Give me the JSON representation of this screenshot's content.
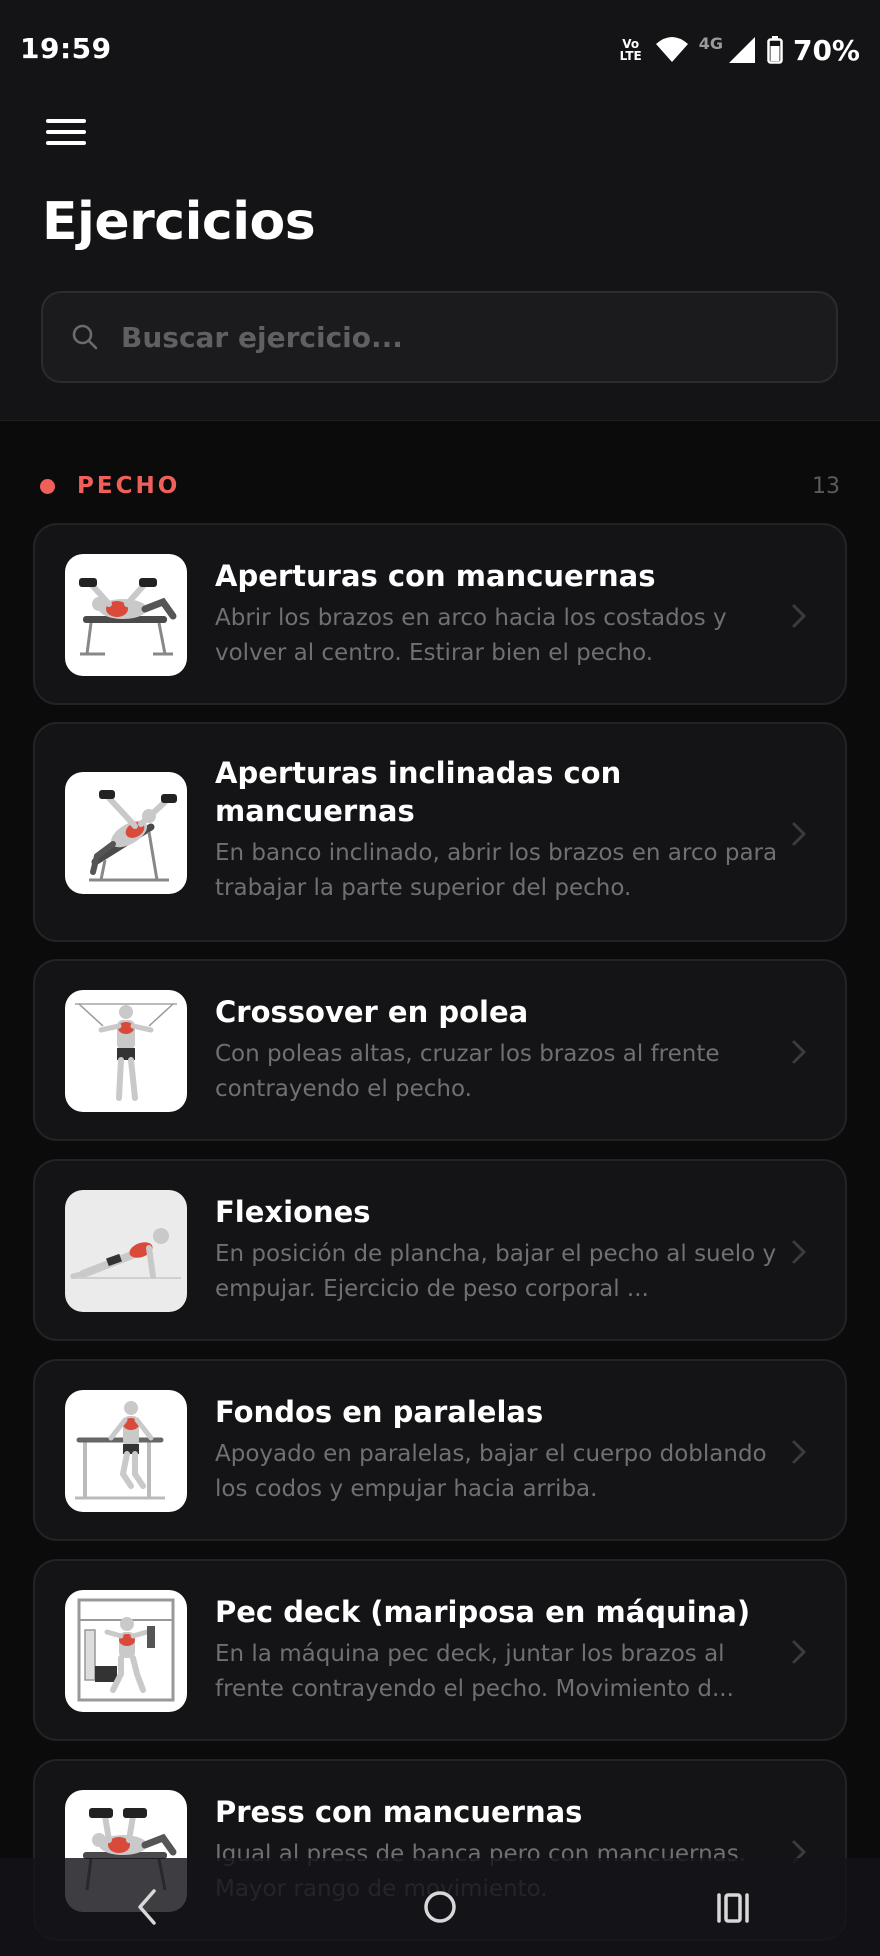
{
  "status_bar": {
    "time": "19:59",
    "volte_top": "Vo",
    "volte_bottom": "LTE",
    "network": "4G",
    "battery": "70%"
  },
  "header": {
    "title": "Ejercicios",
    "search_placeholder": "Buscar ejercicio..."
  },
  "section": {
    "label": "PECHO",
    "count": "13",
    "accent_color": "#f0605a"
  },
  "exercises": [
    {
      "title": "Aperturas con mancuernas",
      "description": "Abrir los brazos en arco hacia los costados y volver al centro. Estirar bien el pecho."
    },
    {
      "title": "Aperturas inclinadas con mancuernas",
      "description": "En banco inclinado, abrir los brazos en arco para trabajar la parte superior del pecho."
    },
    {
      "title": "Crossover en polea",
      "description": "Con poleas altas, cruzar los brazos al frente contrayendo el pecho."
    },
    {
      "title": "Flexiones",
      "description": "En posición de plancha, bajar el pecho al suelo y empujar. Ejercicio de peso corporal ..."
    },
    {
      "title": "Fondos en paralelas",
      "description": "Apoyado en paralelas, bajar el cuerpo doblando los codos y empujar hacia arriba."
    },
    {
      "title": "Pec deck (mariposa en máquina)",
      "description": "En la máquina pec deck, juntar los brazos al frente contrayendo el pecho. Movimiento d..."
    },
    {
      "title": "Press con mancuernas",
      "description": "Igual al press de banca pero con mancuernas. Mayor rango de movimiento."
    }
  ],
  "nav": {
    "back_icon": "back-icon",
    "home_icon": "home-icon",
    "recents_icon": "recents-icon"
  }
}
